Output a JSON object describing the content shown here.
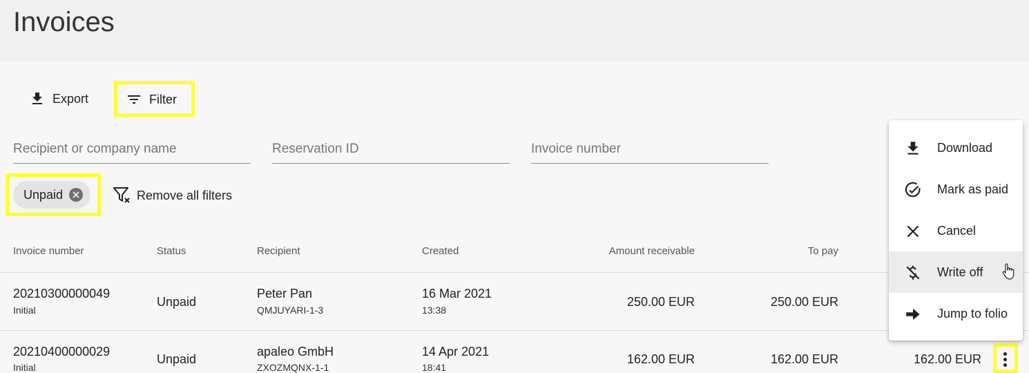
{
  "page": {
    "title": "Invoices"
  },
  "toolbar": {
    "export_label": "Export",
    "filter_label": "Filter"
  },
  "filters": {
    "recipient_placeholder": "Recipient or company name",
    "reservation_placeholder": "Reservation ID",
    "invoice_placeholder": "Invoice number",
    "chip_label": "Unpaid",
    "remove_all_label": "Remove all filters"
  },
  "table": {
    "headers": [
      "Invoice number",
      "Status",
      "Recipient",
      "Created",
      "Amount receivable",
      "To pay"
    ],
    "rows": [
      {
        "number": "20210300000049",
        "type": "Initial",
        "status": "Unpaid",
        "recipient": "Peter Pan",
        "reservation": "QMJUYARI-1-3",
        "date": "16 Mar 2021",
        "time": "13:38",
        "amount": "250.00 EUR",
        "to_pay": "250.00 EUR"
      },
      {
        "number": "20210400000029",
        "type": "Initial",
        "status": "Unpaid",
        "recipient": "apaleo GmbH",
        "reservation": "ZXOZMQNX-1-1",
        "date": "14 Apr 2021",
        "time": "18:41",
        "amount": "162.00 EUR",
        "to_pay": "162.00 EUR",
        "extra": "162.00 EUR"
      }
    ]
  },
  "menu": {
    "items": [
      {
        "label": "Download",
        "icon": "download-icon"
      },
      {
        "label": "Mark as paid",
        "icon": "check-circle-icon"
      },
      {
        "label": "Cancel",
        "icon": "close-icon"
      },
      {
        "label": "Write off",
        "icon": "money-off-icon"
      },
      {
        "label": "Jump to folio",
        "icon": "arrow-right-icon"
      }
    ]
  },
  "colors": {
    "highlight": "#ffff33",
    "background": "#f7f7f7",
    "header_bg": "#f0f0f0"
  }
}
